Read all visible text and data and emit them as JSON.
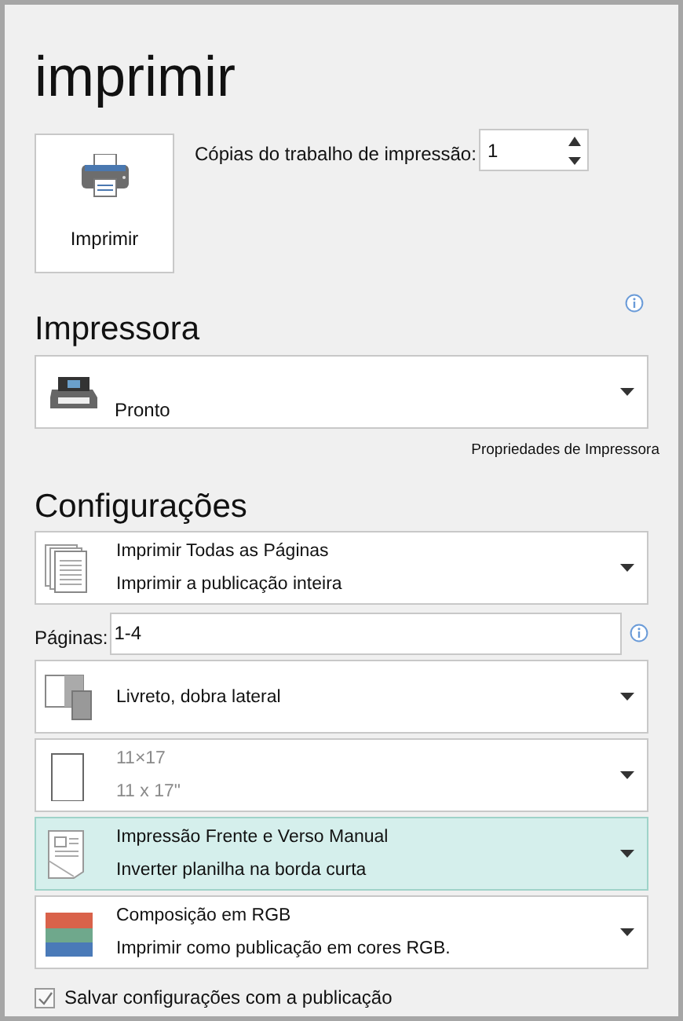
{
  "title": "imprimir",
  "print_button": {
    "label": "Imprimir"
  },
  "copies": {
    "label": "Cópias do trabalho de impressão:",
    "value": "1"
  },
  "printer": {
    "heading": "Impressora",
    "status": "Pronto",
    "properties_link": "Propriedades de Impressora"
  },
  "settings": {
    "heading": "Configurações",
    "items": [
      {
        "kind": "pages",
        "line1": "Imprimir Todas as Páginas",
        "line2": "Imprimir a publicação inteira",
        "disabled": false,
        "highlighted": false
      },
      {
        "kind": "pages_field",
        "label": "Páginas:",
        "value": "1-4"
      },
      {
        "kind": "booklet",
        "line1": "Livreto, dobra lateral",
        "disabled": false,
        "highlighted": false
      },
      {
        "kind": "paper",
        "line1": "11×17",
        "line2": "11 x 17\"",
        "disabled": true,
        "highlighted": false
      },
      {
        "kind": "duplex",
        "line1": "Impressão Frente e Verso Manual",
        "line2": "Inverter planilha na borda curta",
        "disabled": false,
        "highlighted": true
      },
      {
        "kind": "color",
        "line1": "Composição em RGB",
        "line2": "Imprimir como publicação em cores RGB.",
        "disabled": false,
        "highlighted": false
      }
    ]
  },
  "save_settings": {
    "label": "Salvar configurações com a publicação",
    "checked": true
  }
}
